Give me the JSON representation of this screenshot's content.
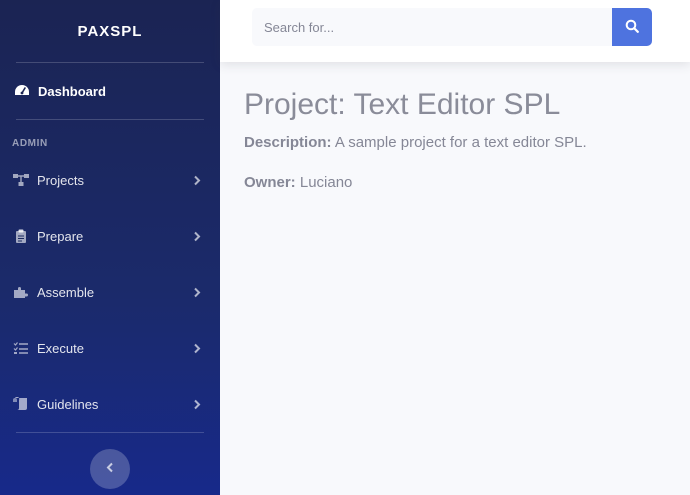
{
  "brand": "PAXSPL",
  "dashboard": {
    "label": "Dashboard",
    "icon": "tachometer-icon"
  },
  "sidebar": {
    "section_heading": "ADMIN",
    "items": [
      {
        "label": "Projects",
        "icon": "sitemap-icon"
      },
      {
        "label": "Prepare",
        "icon": "clipboard-icon"
      },
      {
        "label": "Assemble",
        "icon": "puzzle-icon"
      },
      {
        "label": "Execute",
        "icon": "tasks-icon"
      },
      {
        "label": "Guidelines",
        "icon": "scroll-icon"
      }
    ],
    "toggle_icon": "chevron-left-icon"
  },
  "search": {
    "placeholder": "Search for...",
    "value": "",
    "icon": "search-icon"
  },
  "project": {
    "title": "Project: Text Editor SPL",
    "description_label": "Description:",
    "description": "A sample project for a text editor SPL.",
    "owner_label": "Owner:",
    "owner": "Luciano"
  },
  "colors": {
    "accent": "#4e73df",
    "sidebar": "#1b2a6b",
    "text": "#858796"
  }
}
